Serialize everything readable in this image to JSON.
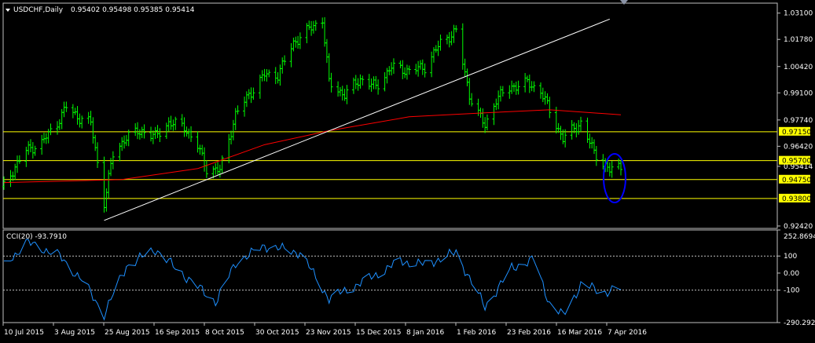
{
  "main_chart": {
    "caption_symbol": "USDCHF,Daily",
    "caption_ohlc": "0.95402 0.95498 0.95385 0.95414",
    "y_axis_labels": [
      "1.03100",
      "1.01780",
      "1.00420",
      "0.99100",
      "0.97740",
      "0.96420",
      "0.95414",
      "0.92420"
    ],
    "yellow_levels": [
      "0.97150",
      "0.95700",
      "0.94750",
      "0.93800"
    ],
    "current_price": "0.95414",
    "colors": {
      "bull_bear_bars": "#00ff00",
      "moving_average": "#ff0000",
      "trendline": "#ffffff",
      "levels": "#ffff00",
      "ellipse": "#0000ff",
      "grid_border": "#c0c0c0"
    }
  },
  "indicator": {
    "caption": "CCI(20) -93.7910",
    "y_axis_labels": [
      "252.8694",
      "100",
      "0.00",
      "-100",
      "-290.2924"
    ],
    "line_color": "#1e90ff"
  },
  "x_axis_labels": [
    "10 Jul 2015",
    "3 Aug 2015",
    "25 Aug 2015",
    "16 Sep 2015",
    "8 Oct 2015",
    "30 Oct 2015",
    "23 Nov 2015",
    "15 Dec 2015",
    "8 Jan 2016",
    "1 Feb 2016",
    "23 Feb 2016",
    "16 Mar 2016",
    "7 Apr 2016"
  ],
  "chart_data": [
    {
      "type": "line",
      "title": "USDCHF,Daily",
      "series": [
        {
          "name": "USDCHF",
          "points": [
            {
              "date": "2015-07-10",
              "close": 0.944
            },
            {
              "date": "2015-07-15",
              "close": 0.954
            },
            {
              "date": "2015-07-20",
              "close": 0.962
            },
            {
              "date": "2015-07-27",
              "close": 0.966
            },
            {
              "date": "2015-08-03",
              "close": 0.976
            },
            {
              "date": "2015-08-07",
              "close": 0.984
            },
            {
              "date": "2015-08-12",
              "close": 0.979
            },
            {
              "date": "2015-08-18",
              "close": 0.976
            },
            {
              "date": "2015-08-24",
              "close": 0.936
            },
            {
              "date": "2015-08-28",
              "close": 0.96
            },
            {
              "date": "2015-09-03",
              "close": 0.969
            },
            {
              "date": "2015-09-10",
              "close": 0.972
            },
            {
              "date": "2015-09-16",
              "close": 0.969
            },
            {
              "date": "2015-09-22",
              "close": 0.976
            },
            {
              "date": "2015-09-29",
              "close": 0.974
            },
            {
              "date": "2015-10-05",
              "close": 0.964
            },
            {
              "date": "2015-10-09",
              "close": 0.953
            },
            {
              "date": "2015-10-15",
              "close": 0.952
            },
            {
              "date": "2015-10-22",
              "close": 0.98
            },
            {
              "date": "2015-10-28",
              "close": 0.99
            },
            {
              "date": "2015-11-04",
              "close": 1.0
            },
            {
              "date": "2015-11-10",
              "close": 1.0
            },
            {
              "date": "2015-11-17",
              "close": 1.016
            },
            {
              "date": "2015-11-24",
              "close": 1.023
            },
            {
              "date": "2015-11-30",
              "close": 1.028
            },
            {
              "date": "2015-12-03",
              "close": 0.996
            },
            {
              "date": "2015-12-10",
              "close": 0.99
            },
            {
              "date": "2015-12-17",
              "close": 0.998
            },
            {
              "date": "2015-12-24",
              "close": 0.994
            },
            {
              "date": "2015-12-31",
              "close": 1.004
            },
            {
              "date": "2016-01-08",
              "close": 1.002
            },
            {
              "date": "2016-01-15",
              "close": 1.004
            },
            {
              "date": "2016-01-22",
              "close": 1.016
            },
            {
              "date": "2016-01-29",
              "close": 1.022
            },
            {
              "date": "2016-02-04",
              "close": 0.99
            },
            {
              "date": "2016-02-11",
              "close": 0.974
            },
            {
              "date": "2016-02-16",
              "close": 0.988
            },
            {
              "date": "2016-02-23",
              "close": 0.994
            },
            {
              "date": "2016-03-01",
              "close": 0.996
            },
            {
              "date": "2016-03-07",
              "close": 0.992
            },
            {
              "date": "2016-03-11",
              "close": 0.982
            },
            {
              "date": "2016-03-17",
              "close": 0.968
            },
            {
              "date": "2016-03-25",
              "close": 0.976
            },
            {
              "date": "2016-03-31",
              "close": 0.961
            },
            {
              "date": "2016-04-07",
              "close": 0.952
            },
            {
              "date": "2016-04-12",
              "close": 0.9541
            }
          ]
        },
        {
          "name": "Moving Average",
          "points": [
            {
              "date": "2015-07-10",
              "close": 0.946
            },
            {
              "date": "2015-09-01",
              "close": 0.9475
            },
            {
              "date": "2015-10-05",
              "close": 0.953
            },
            {
              "date": "2015-11-04",
              "close": 0.965
            },
            {
              "date": "2015-12-03",
              "close": 0.972
            },
            {
              "date": "2016-01-08",
              "close": 0.979
            },
            {
              "date": "2016-02-11",
              "close": 0.981
            },
            {
              "date": "2016-03-11",
              "close": 0.9825
            },
            {
              "date": "2016-04-12",
              "close": 0.98
            }
          ]
        },
        {
          "name": "Trendline",
          "points": [
            {
              "date": "2015-08-24",
              "close": 0.927
            },
            {
              "date": "2016-04-07",
              "close": 1.028
            }
          ]
        }
      ],
      "horizontal_levels": [
        0.9715,
        0.957,
        0.9475,
        0.938
      ],
      "ylim": [
        0.923,
        1.036
      ]
    },
    {
      "type": "line",
      "title": "CCI(20) -93.7910",
      "series": [
        {
          "name": "CCI(20)",
          "points": [
            {
              "date": "2015-07-10",
              "value": 40
            },
            {
              "date": "2015-07-20",
              "value": 180
            },
            {
              "date": "2015-08-03",
              "value": 110
            },
            {
              "date": "2015-08-14",
              "value": -40
            },
            {
              "date": "2015-08-24",
              "value": -240
            },
            {
              "date": "2015-09-03",
              "value": 40
            },
            {
              "date": "2015-09-16",
              "value": 140
            },
            {
              "date": "2015-09-25",
              "value": 30
            },
            {
              "date": "2015-10-05",
              "value": -80
            },
            {
              "date": "2015-10-13",
              "value": -170
            },
            {
              "date": "2015-10-22",
              "value": 60
            },
            {
              "date": "2015-11-04",
              "value": 160
            },
            {
              "date": "2015-11-20",
              "value": 120
            },
            {
              "date": "2015-12-03",
              "value": -150
            },
            {
              "date": "2015-12-17",
              "value": -60
            },
            {
              "date": "2016-01-04",
              "value": 70
            },
            {
              "date": "2016-01-15",
              "value": 50
            },
            {
              "date": "2016-01-29",
              "value": 120
            },
            {
              "date": "2016-02-11",
              "value": -200
            },
            {
              "date": "2016-02-23",
              "value": 30
            },
            {
              "date": "2016-03-04",
              "value": 80
            },
            {
              "date": "2016-03-11",
              "value": -180
            },
            {
              "date": "2016-03-17",
              "value": -250
            },
            {
              "date": "2016-03-25",
              "value": -70
            },
            {
              "date": "2016-04-05",
              "value": -110
            },
            {
              "date": "2016-04-12",
              "value": -94
            }
          ]
        }
      ],
      "levels": [
        100,
        0,
        -100
      ],
      "ylim": [
        -290.2924,
        252.8694
      ]
    }
  ]
}
